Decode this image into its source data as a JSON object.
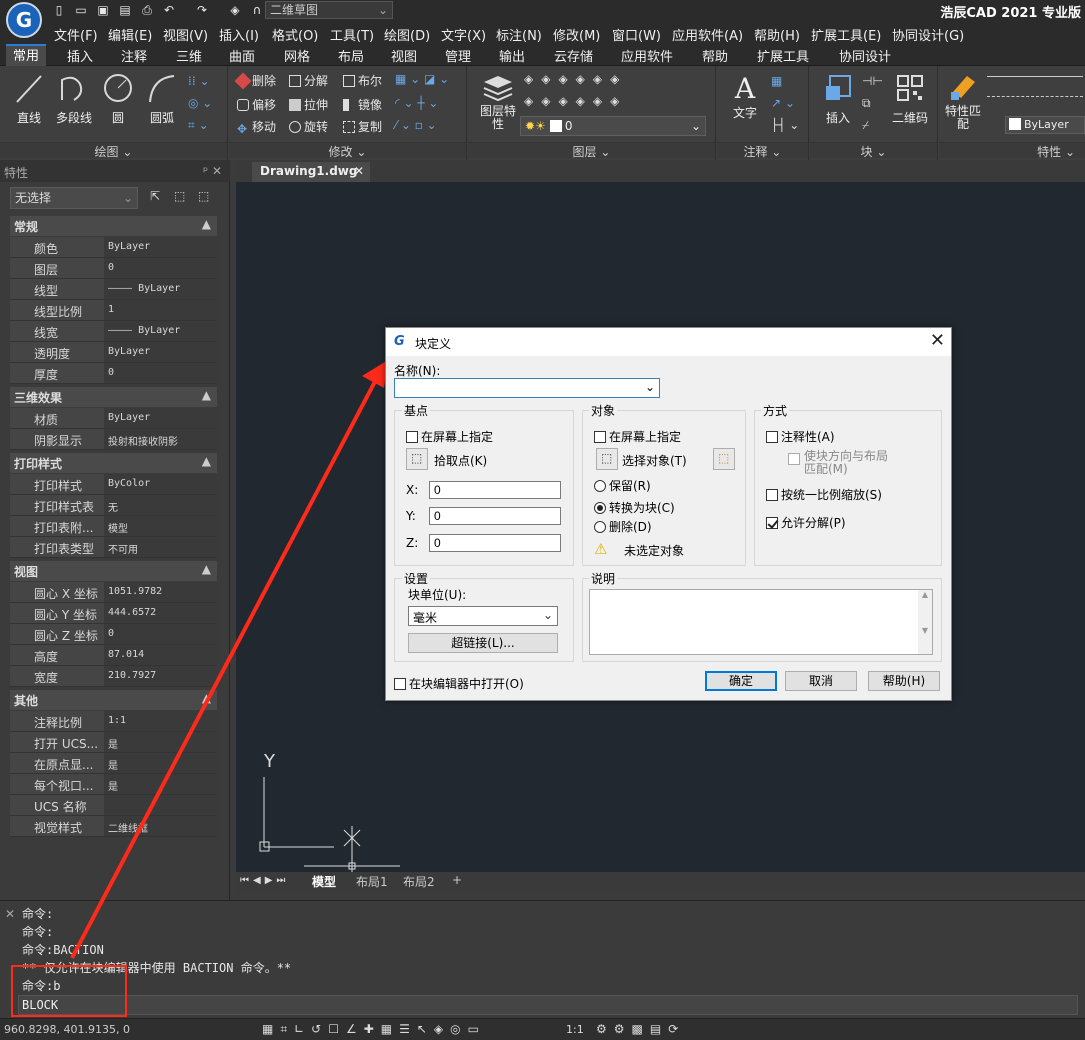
{
  "app": {
    "logo": "G",
    "title": "浩辰CAD 2021 专业版",
    "workspace": "二维草图"
  },
  "menu": [
    "文件(F)",
    "编辑(E)",
    "视图(V)",
    "插入(I)",
    "格式(O)",
    "工具(T)",
    "绘图(D)",
    "文字(X)",
    "标注(N)",
    "修改(M)",
    "窗口(W)",
    "应用软件(A)",
    "帮助(H)",
    "扩展工具(E)",
    "协同设计(G)"
  ],
  "ribbon_tabs": [
    "常用",
    "插入",
    "注释",
    "三维",
    "曲面",
    "网格",
    "布局",
    "视图",
    "管理",
    "输出",
    "云存储",
    "应用软件",
    "帮助",
    "扩展工具",
    "协同设计"
  ],
  "ribbon": {
    "draw": {
      "title": "绘图",
      "line": "直线",
      "pline": "多段线",
      "circle": "圆",
      "arc": "圆弧"
    },
    "modify": {
      "title": "修改",
      "erase": "删除",
      "explode": "分解",
      "boolean": "布尔",
      "offset": "偏移",
      "stretch": "拉伸",
      "mirror": "镜像",
      "move": "移动",
      "rotate": "旋转",
      "copy": "复制"
    },
    "layer": {
      "title": "图层",
      "props_label": "图层特性",
      "current": "0"
    },
    "annot": {
      "title": "注释",
      "text": "文字"
    },
    "block": {
      "title": "块",
      "insert": "插入",
      "qrcode": "二维码"
    },
    "properties": {
      "title": "特性",
      "match": "特性匹配",
      "bylayer": "ByLayer"
    }
  },
  "props_panel": {
    "title": "特性",
    "selection": "无选择",
    "sections": [
      {
        "name": "常规",
        "rows": [
          [
            "颜色",
            "ByLayer"
          ],
          [
            "图层",
            "0"
          ],
          [
            "线型",
            "———— ByLayer"
          ],
          [
            "线型比例",
            "1"
          ],
          [
            "线宽",
            "———— ByLayer"
          ],
          [
            "透明度",
            "ByLayer"
          ],
          [
            "厚度",
            "0"
          ]
        ]
      },
      {
        "name": "三维效果",
        "rows": [
          [
            "材质",
            "ByLayer"
          ],
          [
            "阴影显示",
            "投射和接收阴影"
          ]
        ]
      },
      {
        "name": "打印样式",
        "rows": [
          [
            "打印样式",
            "ByColor"
          ],
          [
            "打印样式表",
            "无"
          ],
          [
            "打印表附...",
            "模型"
          ],
          [
            "打印表类型",
            "不可用"
          ]
        ]
      },
      {
        "name": "视图",
        "rows": [
          [
            "圆心 X 坐标",
            "1051.9782"
          ],
          [
            "圆心 Y 坐标",
            "444.6572"
          ],
          [
            "圆心 Z 坐标",
            "0"
          ],
          [
            "高度",
            "87.014"
          ],
          [
            "宽度",
            "210.7927"
          ]
        ]
      },
      {
        "name": "其他",
        "rows": [
          [
            "注释比例",
            "1:1"
          ],
          [
            "打开 UCS...",
            "是"
          ],
          [
            "在原点显...",
            "是"
          ],
          [
            "每个视口...",
            "是"
          ],
          [
            "UCS 名称",
            ""
          ],
          [
            "视觉样式",
            "二维线框"
          ]
        ]
      }
    ]
  },
  "drawing": {
    "tab": "Drawing1.dwg",
    "layout_tabs": [
      "模型",
      "布局1",
      "布局2",
      "+"
    ],
    "ucs_y": "Y"
  },
  "command_lines": [
    "命令:",
    "命令:",
    "命令:BACTION",
    "** 仅允许在块编辑器中使用 BACTION 命令。**",
    "命令:b",
    "BLOCK"
  ],
  "status": {
    "coords": "960.8298, 401.9135, 0",
    "scale": "1:1"
  },
  "dialog": {
    "title": "块定义",
    "name_label": "名称(N):",
    "name_value": "",
    "base": {
      "title": "基点",
      "on_screen": "在屏幕上指定",
      "pick": "拾取点(K)",
      "x_label": "X:",
      "y_label": "Y:",
      "z_label": "Z:",
      "x": "0",
      "y": "0",
      "z": "0"
    },
    "objects": {
      "title": "对象",
      "on_screen": "在屏幕上指定",
      "select": "选择对象(T)",
      "retain": "保留(R)",
      "convert": "转换为块(C)",
      "delete": "删除(D)",
      "warning": "未选定对象"
    },
    "behavior": {
      "title": "方式",
      "annotative": "注释性(A)",
      "match_orient": "使块方向与布局匹配(M)",
      "uniform": "按统一比例缩放(S)",
      "explode": "允许分解(P)"
    },
    "settings": {
      "title": "设置",
      "unit_label": "块单位(U):",
      "unit": "毫米",
      "hyperlink": "超链接(L)..."
    },
    "description": {
      "title": "说明"
    },
    "open_editor": "在块编辑器中打开(O)",
    "ok": "确定",
    "cancel": "取消",
    "help": "帮助(H)"
  },
  "colors": {
    "accent": "#2a7fd4",
    "canvas": "#212830",
    "annotation": "#ff2a1a"
  }
}
